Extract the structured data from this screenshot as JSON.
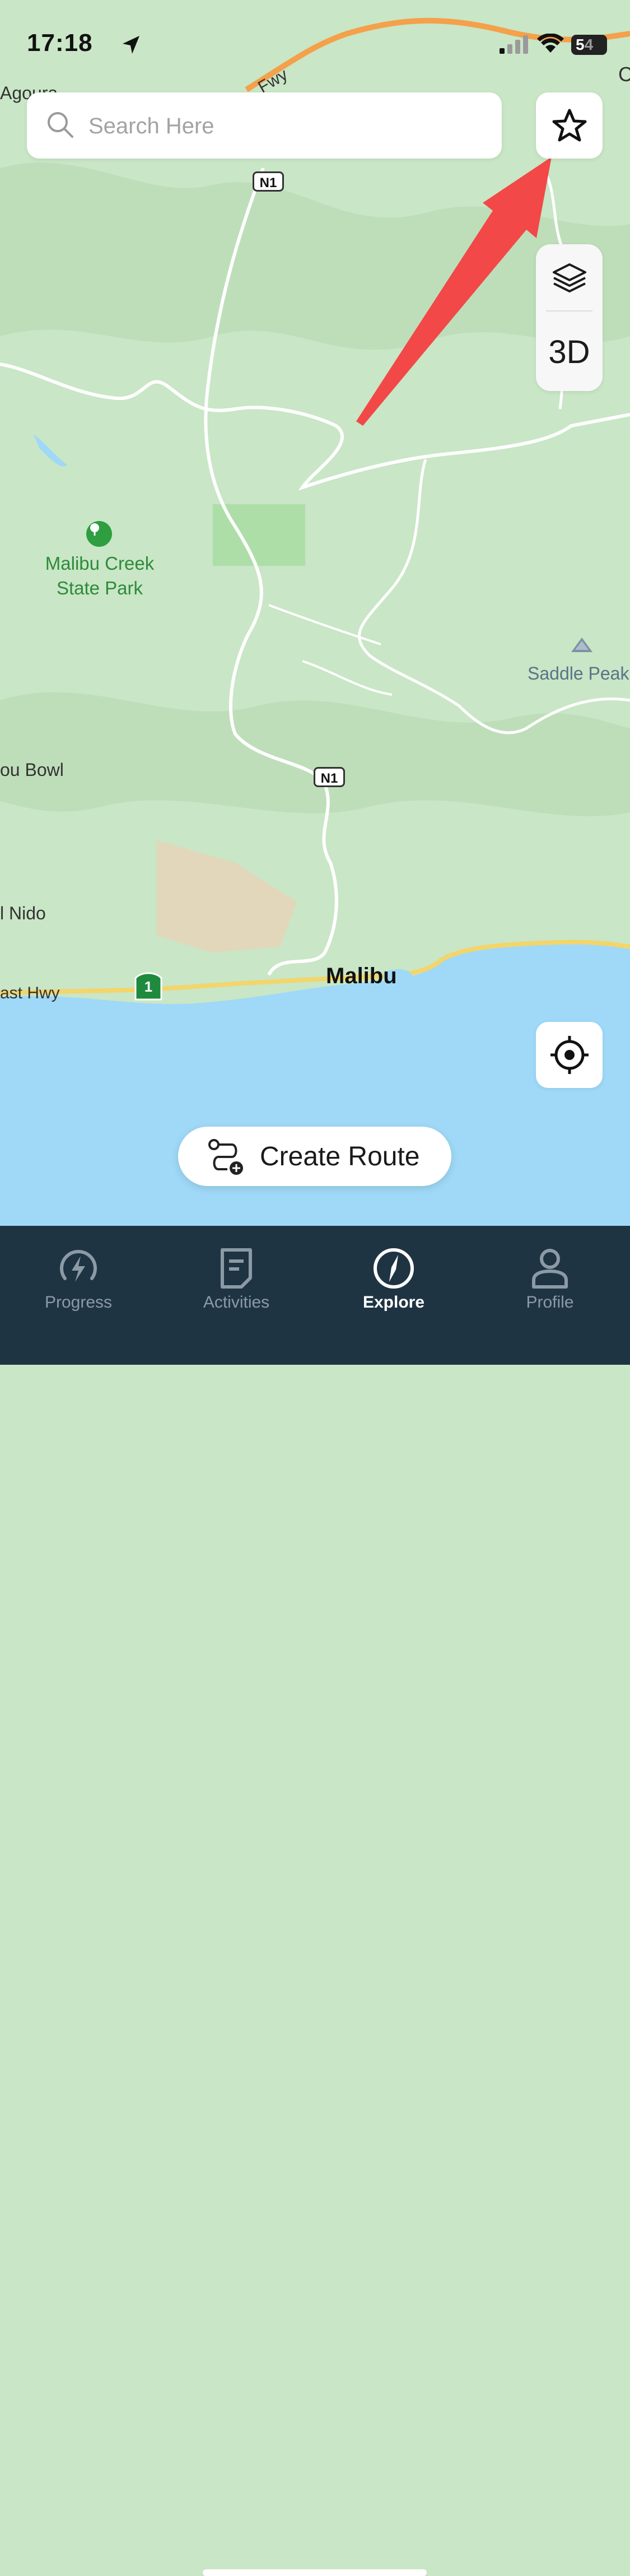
{
  "status_bar": {
    "time": "17:18",
    "battery_digit": "5",
    "battery_rest": "4"
  },
  "search": {
    "placeholder": "Search Here"
  },
  "map_controls": {
    "three_d_label": "3D"
  },
  "map_labels": {
    "agoura": "Agoura",
    "fwy": "Fwy",
    "edge_c": "C",
    "malibu_creek": "Malibu Creek",
    "state_park": "State Park",
    "saddle_peak": "Saddle Peak",
    "bou_bowl": "ou Bowl",
    "el_nido": "l Nido",
    "coast_hwy": "ast Hwy",
    "malibu": "Malibu",
    "route_n1_top": "N1",
    "route_n1_mid": "N1",
    "route_1": "1"
  },
  "create_route": {
    "label": "Create Route"
  },
  "tabbar": {
    "tabs": [
      {
        "label": "Progress",
        "icon": "bolt-icon",
        "active": false
      },
      {
        "label": "Activities",
        "icon": "document-icon",
        "active": false
      },
      {
        "label": "Explore",
        "icon": "compass-icon",
        "active": true
      },
      {
        "label": "Profile",
        "icon": "person-icon",
        "active": false
      }
    ]
  },
  "colors": {
    "map_land": "#c9e6c6",
    "water": "#9fd9f7",
    "arrow": "#f24848",
    "tabbar_bg": "#1f3443",
    "park_green": "#2e8b3a"
  }
}
